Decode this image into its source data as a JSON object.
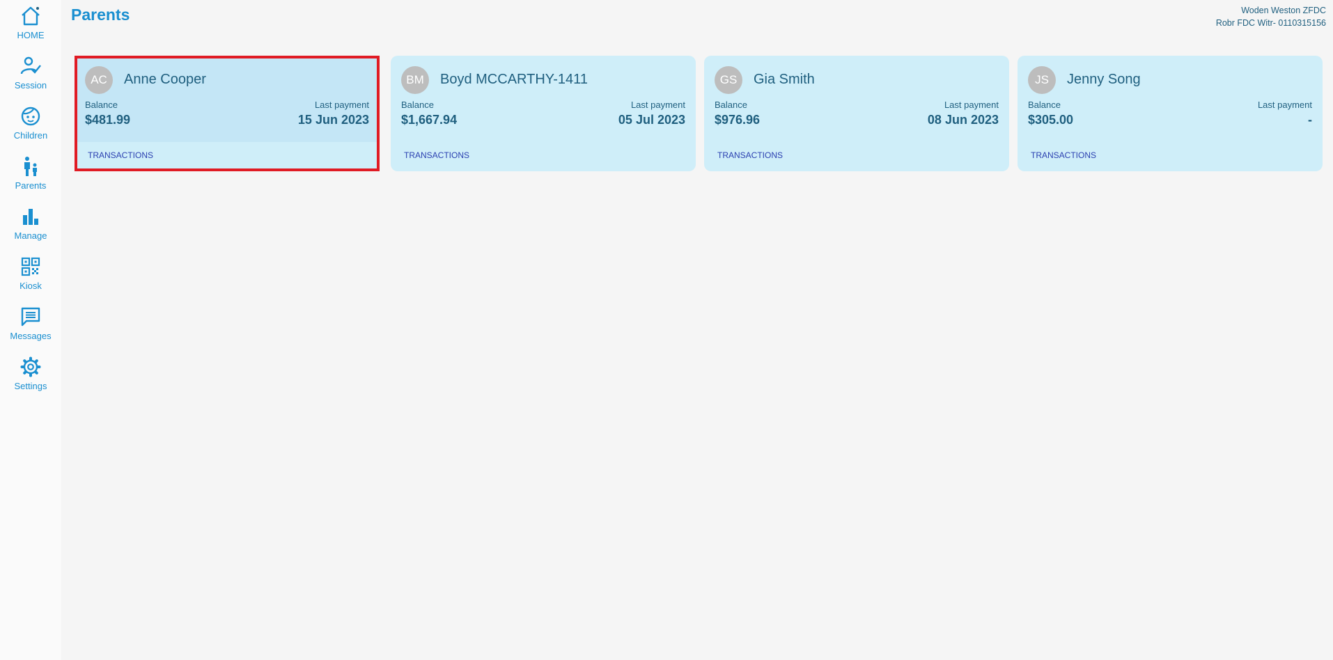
{
  "sidebar": {
    "items": [
      {
        "label": "HOME",
        "icon": "home-icon"
      },
      {
        "label": "Session",
        "icon": "person-check-icon"
      },
      {
        "label": "Children",
        "icon": "child-face-icon"
      },
      {
        "label": "Parents",
        "icon": "parent-child-icon"
      },
      {
        "label": "Manage",
        "icon": "bar-chart-icon"
      },
      {
        "label": "Kiosk",
        "icon": "qr-code-icon"
      },
      {
        "label": "Messages",
        "icon": "message-icon"
      },
      {
        "label": "Settings",
        "icon": "gear-icon"
      }
    ]
  },
  "header": {
    "title": "Parents",
    "org_line1": "Woden Weston ZFDC",
    "org_line2": "Robr FDC Witr- 0110315156"
  },
  "labels": {
    "balance": "Balance",
    "last_payment": "Last payment",
    "transactions": "TRANSACTIONS"
  },
  "cards": [
    {
      "initials": "AC",
      "name": "Anne Cooper",
      "balance": "$481.99",
      "last_payment": "15 Jun 2023"
    },
    {
      "initials": "BM",
      "name": "Boyd MCCARTHY-1411",
      "balance": "$1,667.94",
      "last_payment": "05 Jul 2023"
    },
    {
      "initials": "GS",
      "name": "Gia Smith",
      "balance": "$976.96",
      "last_payment": "08 Jun 2023"
    },
    {
      "initials": "JS",
      "name": "Jenny Song",
      "balance": "$305.00",
      "last_payment": "-"
    }
  ],
  "colors": {
    "accent": "#1a8fd0",
    "card_bg": "#cfeef9",
    "selected_border": "#e01b24",
    "text_dark": "#1f5f7f",
    "link": "#2a3fb0"
  }
}
